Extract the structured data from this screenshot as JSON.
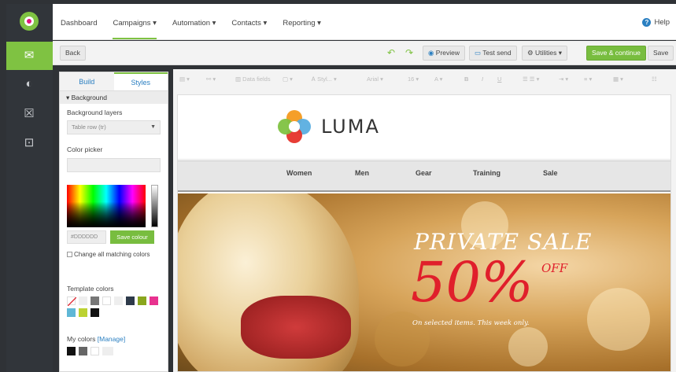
{
  "nav": {
    "items": [
      "Dashboard",
      "Campaigns ▾",
      "Automation ▾",
      "Contacts ▾",
      "Reporting ▾"
    ],
    "active": "Campaigns ▾",
    "help": "Help"
  },
  "toolbar": {
    "back": "Back",
    "preview": "Preview",
    "test_send": "Test send",
    "utilities": "Utilities ▾",
    "save_continue": "Save & continue",
    "save": "Save"
  },
  "panel": {
    "tabs": [
      "Build",
      "Styles"
    ],
    "active_tab": "Styles",
    "section": "▾ Background",
    "bg_layers_label": "Background layers",
    "bg_layers_value": "Table row (tr)",
    "color_picker_label": "Color picker",
    "hex_value": "#DDDDDD",
    "save_colour": "Save colour",
    "change_all": "Change all matching colors",
    "template_colors_label": "Template colors",
    "my_colors_label": "My colors",
    "manage": "[Manage]",
    "template_colors": [
      "#ffffff",
      "#eeeeee",
      "#777777",
      "#ffffff",
      "#eeeeee",
      "#2e3a4a",
      "#8aa61e",
      "#e8328f",
      "#5fb7d6",
      "#bcd232",
      "#111111"
    ],
    "my_colors": [
      "#111111",
      "#666666",
      "#ffffff",
      "#eeeeee"
    ]
  },
  "format_bar": {
    "data_fields": "Data fields",
    "style": "Styl...",
    "font": "Arial",
    "size": "16",
    "bold": "B",
    "italic": "I",
    "underline": "U"
  },
  "email": {
    "brand": "LUMA",
    "nav_links": [
      "Women",
      "Men",
      "Gear",
      "Training",
      "Sale"
    ],
    "hero_title": "PRIVATE SALE",
    "hero_percent": "50%",
    "hero_off": "OFF",
    "hero_note": "On selected items. This week only."
  },
  "colors": {
    "accent_green": "#78bd3f",
    "link_blue": "#2a7fc1",
    "sale_red": "#e01f2b"
  }
}
